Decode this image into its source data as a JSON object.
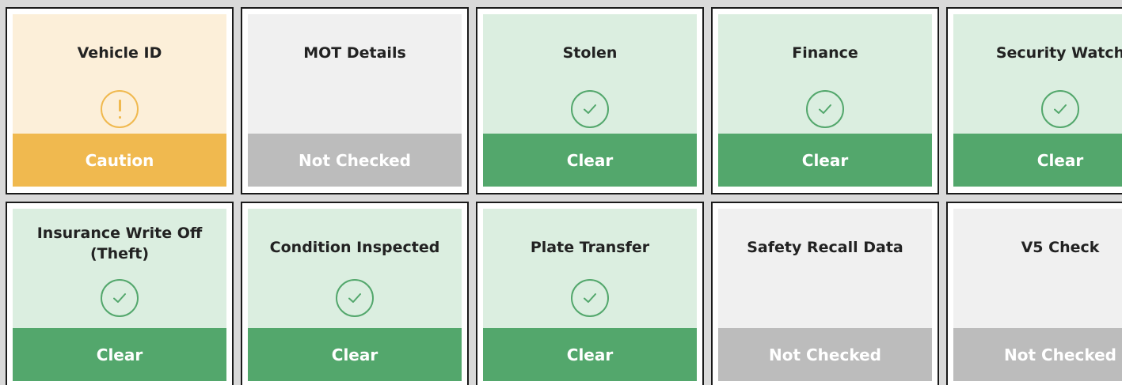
{
  "checks": [
    {
      "title": "Vehicle ID",
      "status": "Caution",
      "icon": "exclamation-icon"
    },
    {
      "title": "MOT Details",
      "status": "Not Checked",
      "icon": "none"
    },
    {
      "title": "Stolen",
      "status": "Clear",
      "icon": "check-icon"
    },
    {
      "title": "Finance",
      "status": "Clear",
      "icon": "check-icon"
    },
    {
      "title": "Security Watch",
      "status": "Clear",
      "icon": "check-icon"
    },
    {
      "title": "Insurance Write Off (Theft)",
      "status": "Clear",
      "icon": "check-icon"
    },
    {
      "title": "Condition Inspected",
      "status": "Clear",
      "icon": "check-icon"
    },
    {
      "title": "Plate Transfer",
      "status": "Clear",
      "icon": "check-icon"
    },
    {
      "title": "Safety Recall Data",
      "status": "Not Checked",
      "icon": "none"
    },
    {
      "title": "V5 Check",
      "status": "Not Checked",
      "icon": "none"
    }
  ],
  "colors": {
    "caution": "#f0b94f",
    "clear": "#53a76c",
    "not_checked": "#bcbcbc"
  }
}
